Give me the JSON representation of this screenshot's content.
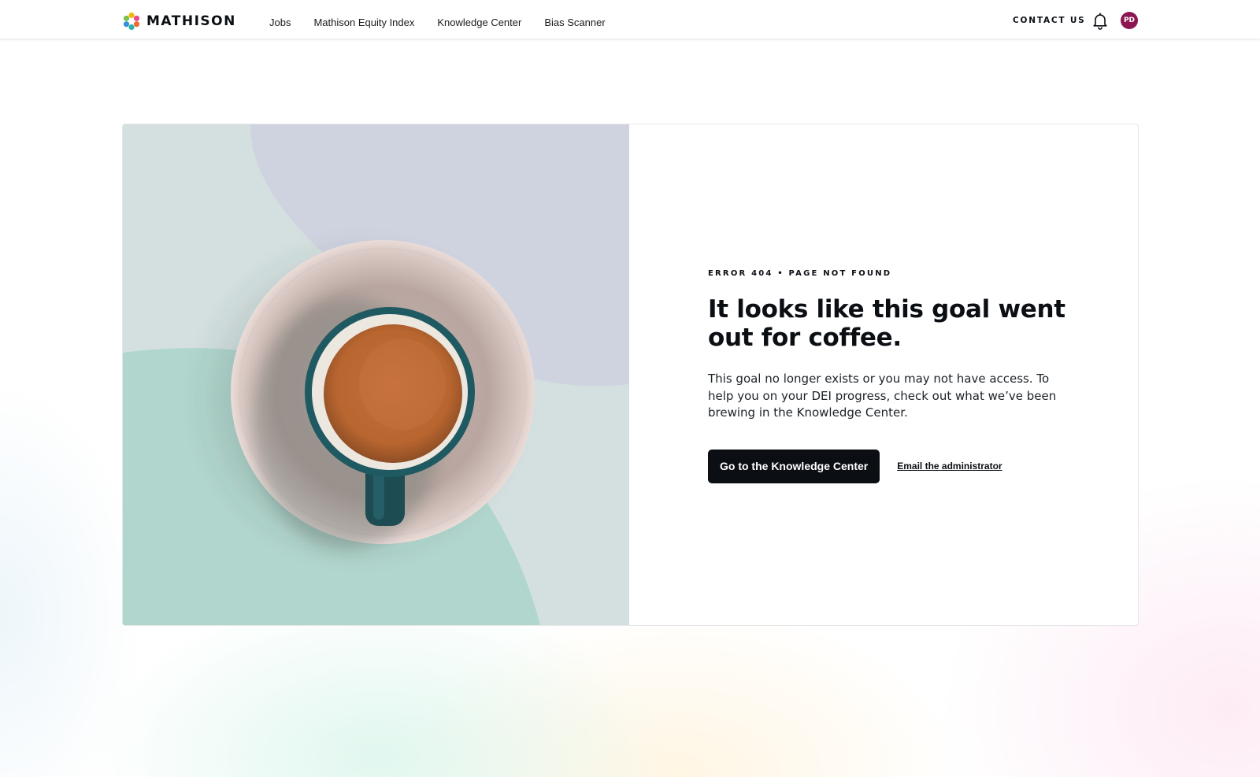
{
  "header": {
    "logo_text": "MATHISON",
    "nav": [
      {
        "label": "Jobs"
      },
      {
        "label": "Mathison Equity Index"
      },
      {
        "label": "Knowledge Center"
      },
      {
        "label": "Bias Scanner"
      }
    ],
    "contact_label": "CONTACT US",
    "avatar_initials": "PD",
    "icons": {
      "logo": "mathison-flower-logo-icon",
      "notifications": "bell-icon"
    },
    "colors": {
      "avatar_bg": "#8c1552"
    }
  },
  "error_card": {
    "eyebrow": "ERROR 404 • PAGE NOT FOUND",
    "title": "It looks like this goal went out for coffee.",
    "body": "This goal no longer exists or you may not have access. To help you on your DEI progress, check out what we’ve been brewing in the Knowledge Center.",
    "primary_button_label": "Go to the Knowledge Center",
    "secondary_link_label": "Email the administrator",
    "colors": {
      "primary_button_bg": "#0b0f14"
    }
  }
}
